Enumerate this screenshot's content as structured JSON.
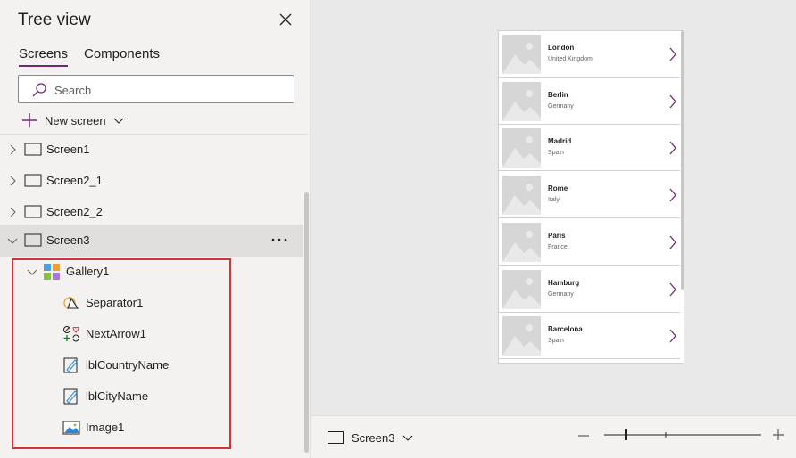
{
  "panel": {
    "title": "Tree view",
    "tabs": [
      {
        "label": "Screens",
        "active": true
      },
      {
        "label": "Components",
        "active": false
      }
    ],
    "search": {
      "placeholder": "Search",
      "value": ""
    },
    "new_screen_label": "New screen"
  },
  "tree": {
    "screens": [
      {
        "label": "Screen1",
        "expanded": false
      },
      {
        "label": "Screen2_1",
        "expanded": false
      },
      {
        "label": "Screen2_2",
        "expanded": false
      },
      {
        "label": "Screen3",
        "expanded": true,
        "selected": true
      }
    ],
    "gallery": {
      "label": "Gallery1",
      "icon": "gallery-icon"
    },
    "children": [
      {
        "label": "Separator1",
        "icon": "separator-icon"
      },
      {
        "label": "NextArrow1",
        "icon": "icons-control-icon"
      },
      {
        "label": "lblCountryName",
        "icon": "label-icon"
      },
      {
        "label": "lblCityName",
        "icon": "label-icon"
      },
      {
        "label": "Image1",
        "icon": "image-icon"
      }
    ]
  },
  "gallery_items": [
    {
      "city": "London",
      "country": "United Kingdom"
    },
    {
      "city": "Berlin",
      "country": "Germany"
    },
    {
      "city": "Madrid",
      "country": "Spain"
    },
    {
      "city": "Rome",
      "country": "Italy"
    },
    {
      "city": "Paris",
      "country": "France"
    },
    {
      "city": "Hamburg",
      "country": "Germany"
    },
    {
      "city": "Barcelona",
      "country": "Spain"
    }
  ],
  "bottom_bar": {
    "screen_selector_label": "Screen3"
  },
  "colors": {
    "accent": "#742774",
    "highlight_border": "#d13438",
    "panel_bg": "#f3f2f1",
    "canvas_bg": "#e9e9e9",
    "arrow": "#742774"
  }
}
